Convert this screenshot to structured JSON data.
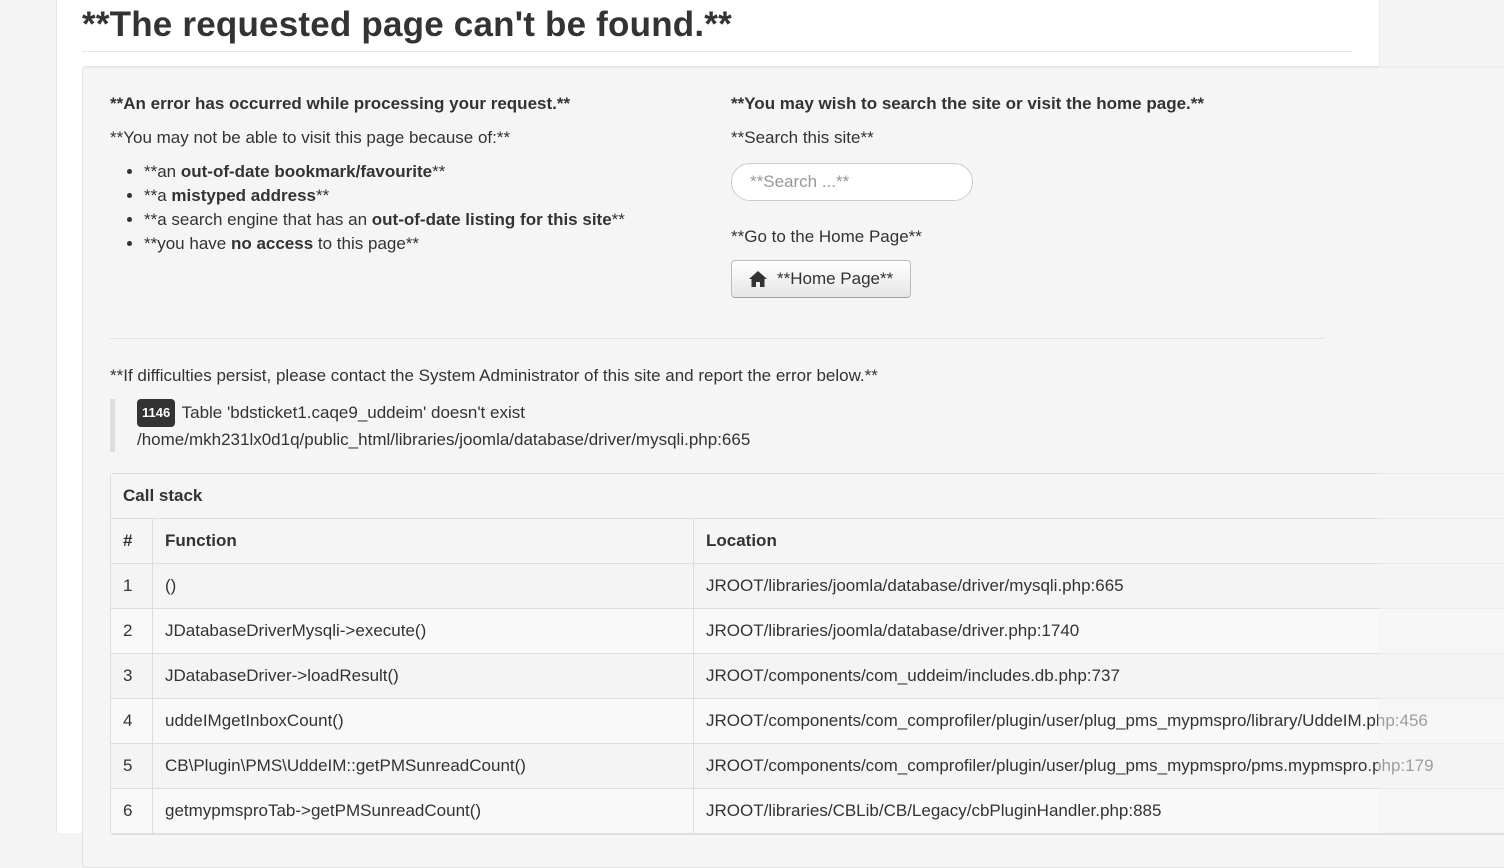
{
  "page": {
    "title": "**The requested page can't be found.**"
  },
  "left": {
    "heading": "**An error has occurred while processing your request.**",
    "intro": "**You may not be able to visit this page because of:**",
    "reasons": [
      {
        "pre": "**an ",
        "bold": "out-of-date bookmark/favourite",
        "post": "**"
      },
      {
        "pre": "**a ",
        "bold": "mistyped address",
        "post": "**"
      },
      {
        "pre": "**a search engine that has an ",
        "bold": "out-of-date listing for this site",
        "post": "**"
      },
      {
        "pre": "**you have ",
        "bold": "no access",
        "post": " to this page**"
      }
    ]
  },
  "right": {
    "heading": "**You may wish to search the site or visit the home page.**",
    "search_label": "**Search this site**",
    "search_placeholder": "**Search ...**",
    "home_label": "**Go to the Home Page**",
    "home_button": "**Home Page**"
  },
  "contact": "**If difficulties persist, please contact the System Administrator of this site and report the error below.**",
  "error": {
    "code": "1146",
    "message": "Table 'bdsticket1.caqe9_uddeim' doesn't exist",
    "path": "/home/mkh231lx0d1q/public_html/libraries/joomla/database/driver/mysqli.php:665"
  },
  "call_stack": {
    "caption": "Call stack",
    "headers": {
      "num": "#",
      "function": "Function",
      "location": "Location"
    },
    "rows": [
      {
        "num": "1",
        "function": "()",
        "location": "JROOT/libraries/joomla/database/driver/mysqli.php:665"
      },
      {
        "num": "2",
        "function": "JDatabaseDriverMysqli->execute()",
        "location": "JROOT/libraries/joomla/database/driver.php:1740"
      },
      {
        "num": "3",
        "function": "JDatabaseDriver->loadResult()",
        "location": "JROOT/components/com_uddeim/includes.db.php:737"
      },
      {
        "num": "4",
        "function": "uddeIMgetInboxCount()",
        "location": "JROOT/components/com_comprofiler/plugin/user/plug_pms_mypmspro/library/UddeIM.php:456"
      },
      {
        "num": "5",
        "function": "CB\\Plugin\\PMS\\UddeIM::getPMSunreadCount()",
        "location": "JROOT/components/com_comprofiler/plugin/user/plug_pms_mypmspro/pms.mypmspro.php:179"
      },
      {
        "num": "6",
        "function": "getmypmsproTab->getPMSunreadCount()",
        "location": "JROOT/libraries/CBLib/CB/Legacy/cbPluginHandler.php:885"
      }
    ]
  }
}
